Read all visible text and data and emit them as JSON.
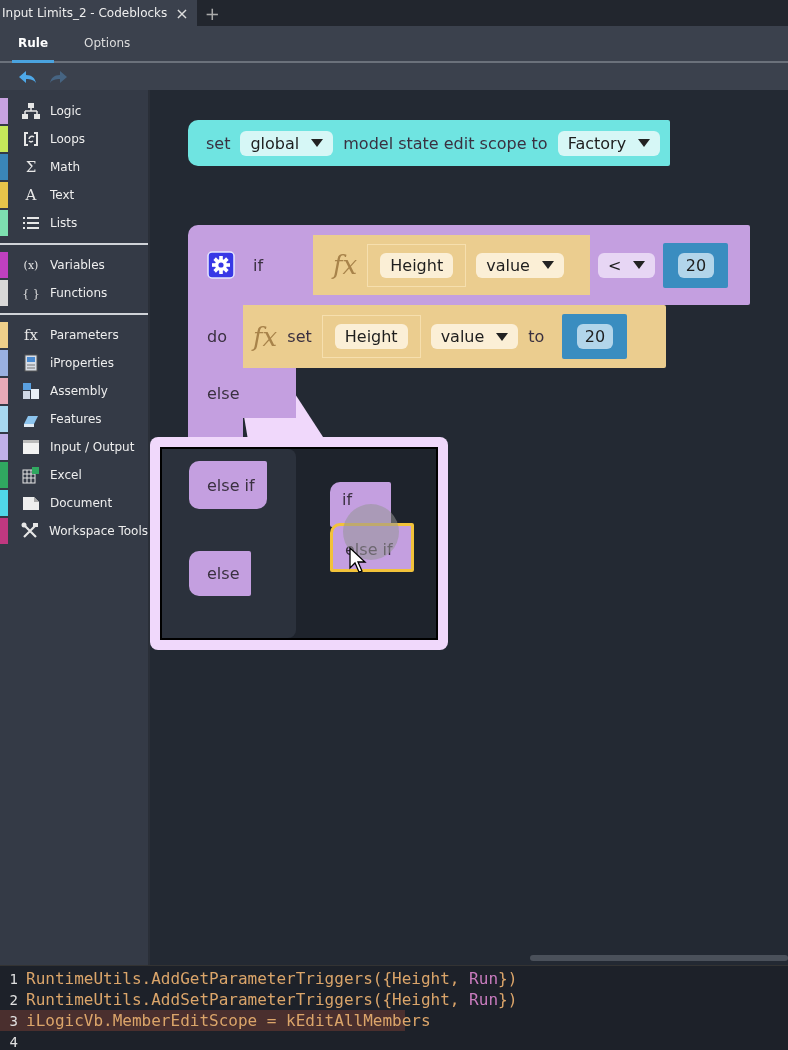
{
  "window": {
    "tab_title": "Input Limits_2 - Codeblocks",
    "close": "×",
    "new_tab": "+"
  },
  "ribbon_tabs": [
    {
      "label": "Rule",
      "selected": true
    },
    {
      "label": "Options",
      "selected": false
    }
  ],
  "toolbar": [
    {
      "kind": "undo",
      "disabled": false
    },
    {
      "kind": "redo",
      "disabled": true
    }
  ],
  "sidebar": {
    "groups": [
      [
        {
          "label": "Logic",
          "color": "#c8a2e0"
        },
        {
          "label": "Loops",
          "color": "#c6e85a"
        },
        {
          "label": "Math",
          "color": "#3a86b8",
          "glyph": "Σ"
        },
        {
          "label": "Text",
          "color": "#e8c44a",
          "glyph": "A"
        },
        {
          "label": "Lists",
          "color": "#7de0b0"
        }
      ],
      [
        {
          "label": "Variables",
          "color": "#c040c0",
          "glyph": "(x)"
        },
        {
          "label": "Functions",
          "color": "#d8d8d8",
          "glyph": "{ }"
        }
      ],
      [
        {
          "label": "Parameters",
          "color": "#f0d08a",
          "glyph": "fx"
        },
        {
          "label": "iProperties",
          "color": "#9ab0e0"
        },
        {
          "label": "Assembly",
          "color": "#e8aab8"
        },
        {
          "label": "Features",
          "color": "#a8d8f0"
        },
        {
          "label": "Input / Output",
          "color": "#c0b0e8"
        },
        {
          "label": "Excel",
          "color": "#30a860"
        },
        {
          "label": "Document",
          "color": "#50d8e8"
        },
        {
          "label": "Workspace Tools",
          "color": "#c03880"
        }
      ]
    ]
  },
  "canvas": {
    "scope_block": {
      "label": "set",
      "scope": "global",
      "text": "model state edit scope to",
      "value": "Factory"
    },
    "if_block": {
      "if_label": "if",
      "condition": {
        "fx": "fx",
        "parameter": "Height",
        "property": "value"
      },
      "operator": "<",
      "operand": "20",
      "do_label": "do",
      "action": {
        "fx": "fx",
        "set_label": "set",
        "parameter": "Height",
        "property": "value",
        "to_label": "to",
        "value": "20"
      },
      "else_label": "else"
    },
    "mutator": {
      "flyout": [
        {
          "label": "else if",
          "kind": "else_if"
        },
        {
          "label": "else",
          "kind": "else"
        }
      ],
      "workspace": [
        {
          "label": "if",
          "selected": false
        },
        {
          "label": "else if",
          "selected": true
        }
      ]
    }
  },
  "code_editor": {
    "lines": [
      {
        "number": "1",
        "highlighted": false,
        "tokens": [
          {
            "text": "RuntimeUtils.AddGetParameterTriggers({",
            "kind": "code"
          },
          {
            "text": "Height",
            "kind": "name"
          },
          {
            "text": ", ",
            "kind": "code"
          },
          {
            "text": "Run",
            "kind": "keyword"
          },
          {
            "text": "})",
            "kind": "code"
          }
        ]
      },
      {
        "number": "2",
        "highlighted": false,
        "tokens": [
          {
            "text": "RuntimeUtils.AddSetParameterTriggers({",
            "kind": "code"
          },
          {
            "text": "Height",
            "kind": "name"
          },
          {
            "text": ", ",
            "kind": "code"
          },
          {
            "text": "Run",
            "kind": "keyword"
          },
          {
            "text": "})",
            "kind": "code"
          }
        ]
      },
      {
        "number": "3",
        "highlighted": true,
        "tokens": [
          {
            "text": "iLogicVb.MemberEditScope = kEditAllMembers",
            "kind": "code"
          }
        ]
      },
      {
        "number": "4",
        "highlighted": false
      }
    ]
  }
}
